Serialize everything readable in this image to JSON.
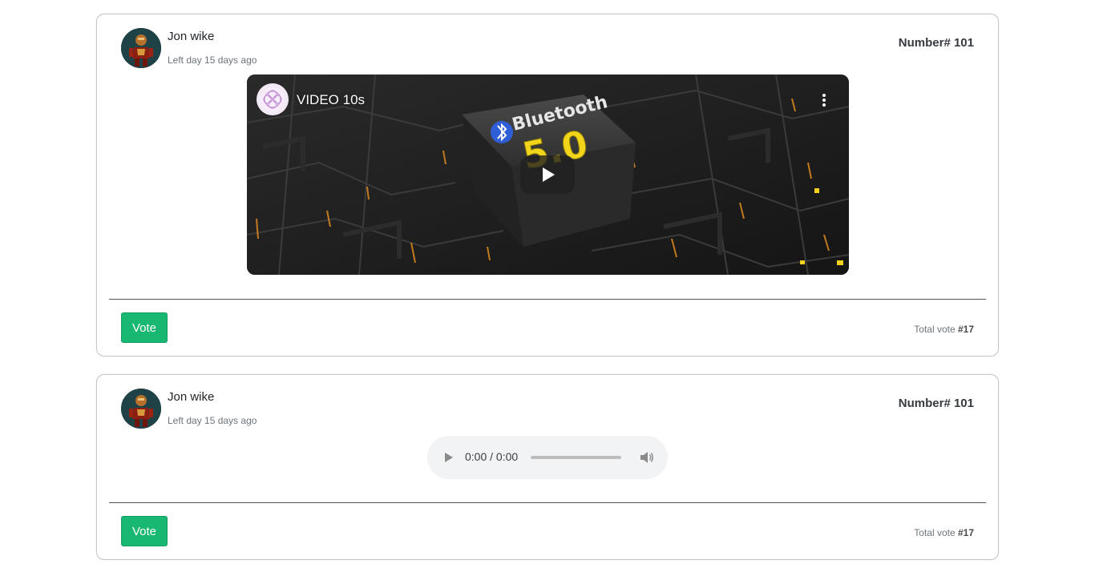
{
  "posts": [
    {
      "author": "Jon wike",
      "posted": "Left day 15 days ago",
      "number": "Number# 101",
      "media": {
        "type": "video",
        "title": "VIDEO 10s",
        "thumbnail_text_brand": "Bluetooth",
        "thumbnail_text_version": "5.0"
      },
      "vote_label": "Vote",
      "total_prefix": "Total vote",
      "total_value": "#17"
    },
    {
      "author": "Jon wike",
      "posted": "Left day 15 days ago",
      "number": "Number# 101",
      "media": {
        "type": "audio",
        "time": "0:00 / 0:00"
      },
      "vote_label": "Vote",
      "total_prefix": "Total vote",
      "total_value": "#17"
    }
  ],
  "colors": {
    "vote_button": "#18b772",
    "card_border": "#c6c6c6",
    "muted_text": "#6c757d"
  },
  "icons": [
    "avatar-icon",
    "channel-logo-icon",
    "play-icon",
    "more-options-icon",
    "volume-icon"
  ]
}
